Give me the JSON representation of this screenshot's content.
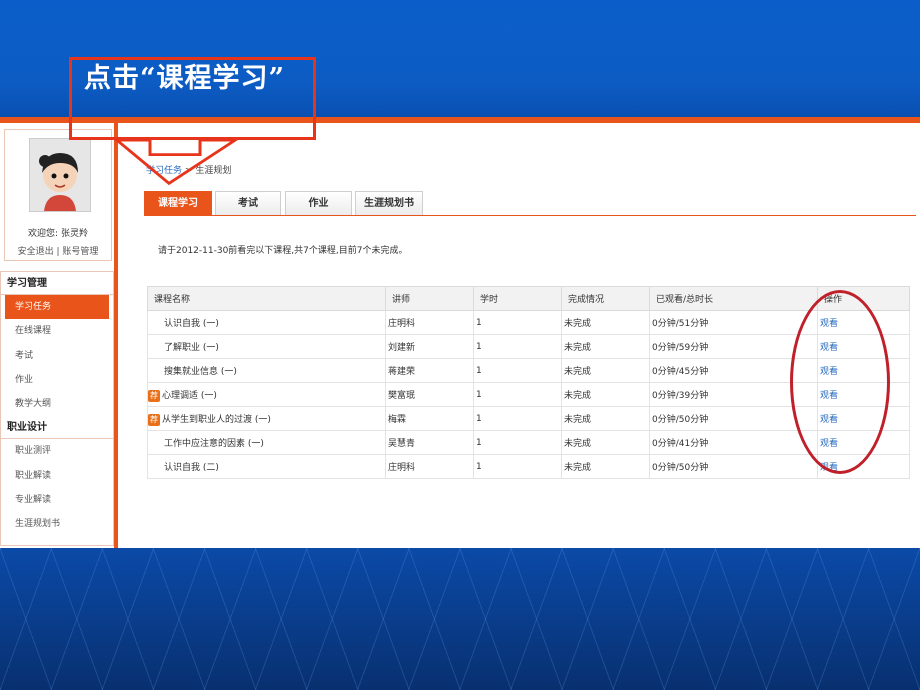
{
  "callout": {
    "text": "点击“课程学习”"
  },
  "sidebar": {
    "welcome_label": "欢迎您:",
    "user_name": "张灵羚",
    "logout": "安全退出",
    "separator": "|",
    "account": "账号管理",
    "groups": [
      {
        "title": "学习管理",
        "items": [
          "学习任务",
          "在线课程",
          "考试",
          "作业",
          "教学大纲"
        ],
        "active_index": 0
      },
      {
        "title": "职业设计",
        "items": [
          "职业测评",
          "职业解读",
          "专业解读",
          "生涯规划书"
        ]
      }
    ]
  },
  "breadcrumb": {
    "root": "学习任务",
    "sep": ">",
    "current": "生涯规划"
  },
  "tabs": [
    "课程学习",
    "考试",
    "作业",
    "生涯规划书"
  ],
  "notice": "请于2012-11-30前看完以下课程,共7个课程,目前7个未完成。",
  "table": {
    "headers": [
      "课程名称",
      "讲师",
      "学时",
      "完成情况",
      "已观看/总时长",
      "操作"
    ],
    "rows": [
      {
        "name": "认识自我 (一)",
        "badge": "",
        "teacher": "庄明科",
        "hours": "1",
        "status": "未完成",
        "progress": "0分钟/51分钟",
        "action": "观看"
      },
      {
        "name": "了解职业 (一)",
        "badge": "",
        "teacher": "刘建新",
        "hours": "1",
        "status": "未完成",
        "progress": "0分钟/59分钟",
        "action": "观看"
      },
      {
        "name": "搜集就业信息 (一)",
        "badge": "",
        "teacher": "蒋建荣",
        "hours": "1",
        "status": "未完成",
        "progress": "0分钟/45分钟",
        "action": "观看"
      },
      {
        "name": "心理调适 (一)",
        "badge": "荐",
        "teacher": "樊富珉",
        "hours": "1",
        "status": "未完成",
        "progress": "0分钟/39分钟",
        "action": "观看"
      },
      {
        "name": "从学生到职业人的过渡 (一)",
        "badge": "荐",
        "teacher": "梅霖",
        "hours": "1",
        "status": "未完成",
        "progress": "0分钟/50分钟",
        "action": "观看"
      },
      {
        "name": "工作中应注意的因素 (一)",
        "badge": "",
        "teacher": "吴慧青",
        "hours": "1",
        "status": "未完成",
        "progress": "0分钟/41分钟",
        "action": "观看"
      },
      {
        "name": "认识自我 (二)",
        "badge": "",
        "teacher": "庄明科",
        "hours": "1",
        "status": "未完成",
        "progress": "0分钟/50分钟",
        "action": "观看"
      }
    ]
  },
  "colors": {
    "accent": "#e8541a",
    "brand_blue": "#0b5ec9",
    "annotation_red": "#c0202a",
    "link": "#2a6bc0"
  }
}
